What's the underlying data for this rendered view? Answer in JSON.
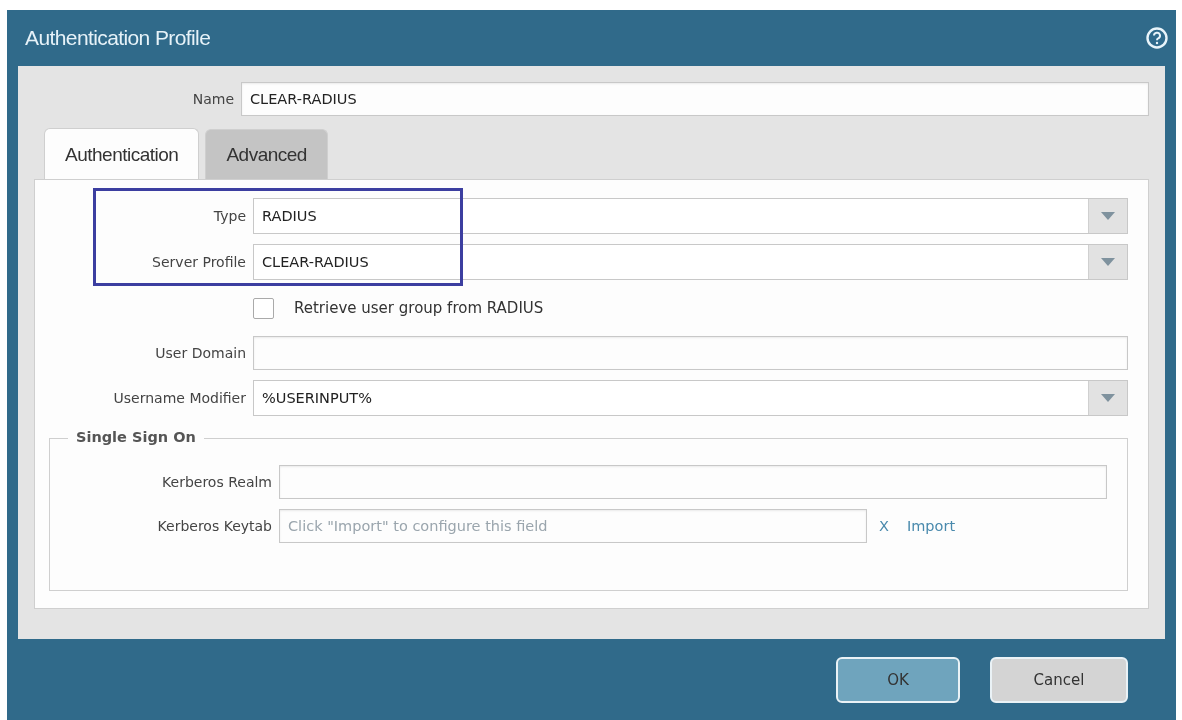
{
  "window": {
    "title": "Authentication Profile"
  },
  "name_field": {
    "label": "Name",
    "value": "CLEAR-RADIUS"
  },
  "tabs": [
    {
      "label": "Authentication",
      "selected": true
    },
    {
      "label": "Advanced",
      "selected": false
    }
  ],
  "fields": [
    {
      "kind": "dropdown",
      "label": "Type",
      "value": "RADIUS",
      "highlighted": true
    },
    {
      "kind": "dropdown",
      "label": "Server Profile",
      "value": "CLEAR-RADIUS",
      "highlighted": true
    },
    {
      "kind": "checkbox",
      "label": "Retrieve user group from RADIUS",
      "checked": false
    },
    {
      "kind": "text",
      "label": "User Domain"
    },
    {
      "kind": "dropdown",
      "label": "Username Modifier",
      "value": "%USERINPUT%"
    }
  ],
  "single_sign_on": {
    "title": "Single Sign On",
    "fields": [
      {
        "kind": "text",
        "label": "Kerberos Realm"
      },
      {
        "kind": "import",
        "label": "Kerberos Keytab",
        "placeholder": "Click \"Import\" to configure this field",
        "clear": "X",
        "action": "Import"
      }
    ]
  },
  "buttons": [
    {
      "label": "OK",
      "kind": "primary"
    },
    {
      "label": "Cancel",
      "kind": "secondary"
    }
  ]
}
